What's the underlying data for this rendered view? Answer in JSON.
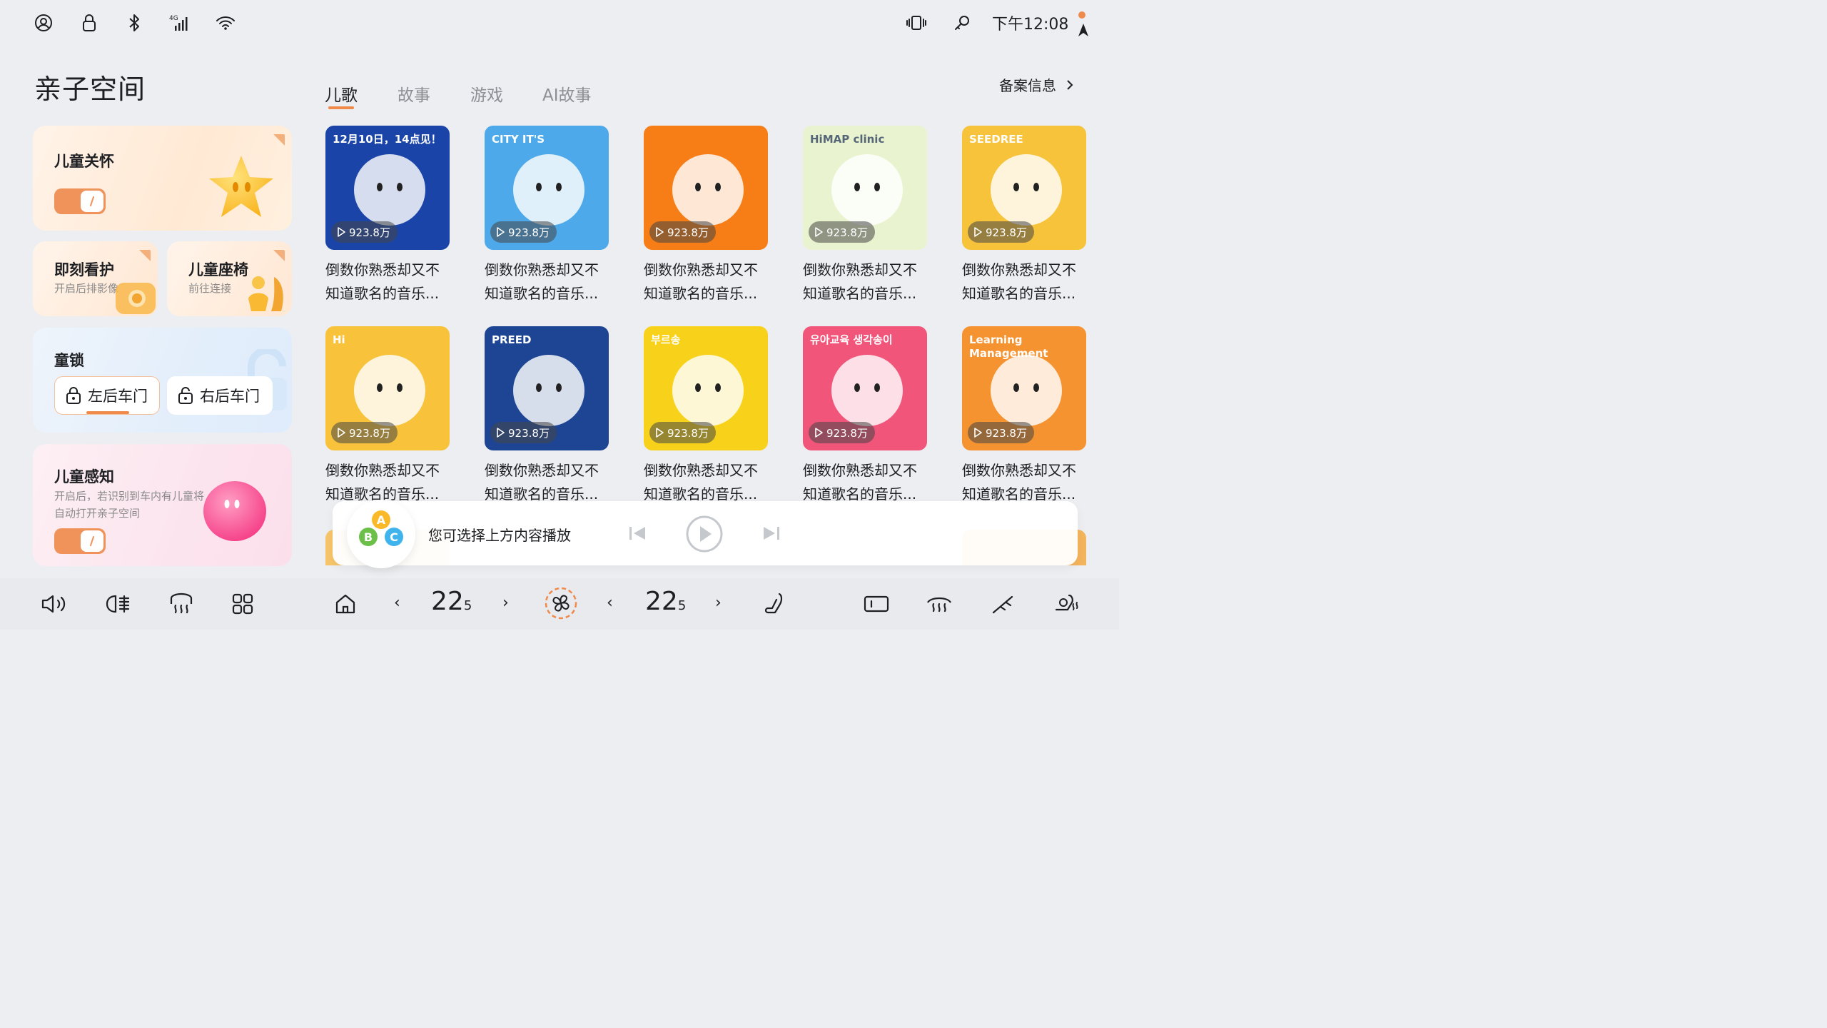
{
  "status_bar": {
    "icons": [
      "account-icon",
      "lock-icon",
      "bluetooth-icon",
      "4g-signal-icon",
      "wifi-icon"
    ],
    "right_icons": [
      "vibrate-icon",
      "key-icon"
    ],
    "time": "下午12:08"
  },
  "page_title": "亲子空间",
  "cards": {
    "child_care": {
      "title": "儿童关怀",
      "toggle_on": true
    },
    "instant_watch": {
      "title": "即刻看护",
      "subtitle": "开启后排影像"
    },
    "child_seat": {
      "title": "儿童座椅",
      "subtitle": "前往连接"
    },
    "child_lock": {
      "title": "童锁",
      "left_door": "左后车门",
      "right_door": "右后车门"
    },
    "child_sense": {
      "title": "儿童感知",
      "subtitle": "开启后，若识别到车内有儿童将自动打开亲子空间",
      "toggle_on": true
    }
  },
  "tabs": [
    "儿歌",
    "故事",
    "游戏",
    "AI故事"
  ],
  "active_tab": "儿歌",
  "record_info": "备案信息",
  "items": [
    {
      "count": "923.8万",
      "title": "倒数你熟悉却又不知道歌名的音乐...",
      "cover_text": "12月10日，14点见！",
      "bg": "#1a44a8"
    },
    {
      "count": "923.8万",
      "title": "倒数你熟悉却又不知道歌名的音乐...",
      "cover_text": "CITY IT'S",
      "bg": "#4da9ea"
    },
    {
      "count": "923.8万",
      "title": "倒数你熟悉却又不知道歌名的音乐...",
      "cover_text": "",
      "bg": "#f77d16"
    },
    {
      "count": "923.8万",
      "title": "倒数你熟悉却又不知道歌名的音乐...",
      "cover_text": "HiMAP clinic",
      "bg": "#e9f3cf"
    },
    {
      "count": "923.8万",
      "title": "倒数你熟悉却又不知道歌名的音乐...",
      "cover_text": "SEEDREE",
      "bg": "#f6c33a"
    },
    {
      "count": "923.8万",
      "title": "倒数你熟悉却又不知道歌名的音乐...",
      "cover_text": "Hi",
      "bg": "#f8c33b"
    },
    {
      "count": "923.8万",
      "title": "倒数你熟悉却又不知道歌名的音乐...",
      "cover_text": "PREED",
      "bg": "#1d4593"
    },
    {
      "count": "923.8万",
      "title": "倒数你熟悉却又不知道歌名的音乐...",
      "cover_text": "부르송",
      "bg": "#f8d21a"
    },
    {
      "count": "923.8万",
      "title": "倒数你熟悉却又不知道歌名的音乐...",
      "cover_text": "유아교육 생각송이",
      "bg": "#f2557a"
    },
    {
      "count": "923.8万",
      "title": "倒数你熟悉却又不知道歌名的音乐...",
      "cover_text": "Learning Management",
      "bg": "#f69331"
    }
  ],
  "player": {
    "prompt": "您可选择上方内容播放",
    "badge_letters": [
      "A",
      "B",
      "C"
    ]
  },
  "dock": {
    "left_temp": "22.5",
    "right_temp": "22.5",
    "left_temp_int": "22",
    "left_temp_dec": "5",
    "right_temp_int": "22",
    "right_temp_dec": "5",
    "icons": [
      "volume-icon",
      "headlight-icon",
      "rear-defrost-icon",
      "apps-grid-icon",
      "home-icon",
      "fan-icon",
      "seat-icon",
      "screen-icon",
      "front-defrost-icon",
      "wiper-icon",
      "seat-heat-icon"
    ]
  },
  "colors": {
    "accent": "#f08a4b",
    "background": "#eceef1"
  }
}
